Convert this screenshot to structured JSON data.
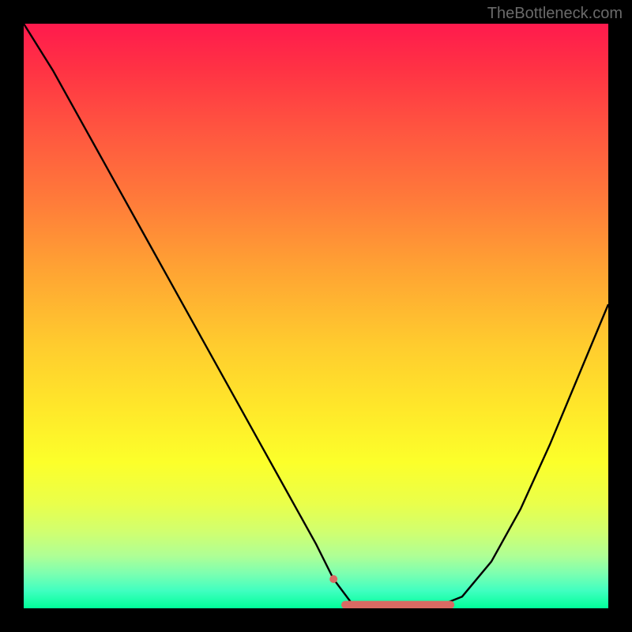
{
  "watermark": "TheBottleneck.com",
  "chart_data": {
    "type": "line",
    "title": "",
    "xlabel": "",
    "ylabel": "",
    "xlim": [
      0,
      100
    ],
    "ylim": [
      0,
      100
    ],
    "series": [
      {
        "name": "bottleneck-curve",
        "x": [
          0,
          5,
          10,
          15,
          20,
          25,
          30,
          35,
          40,
          45,
          50,
          53,
          56,
          60,
          65,
          70,
          75,
          80,
          85,
          90,
          95,
          100
        ],
        "values": [
          100,
          92,
          83,
          74,
          65,
          56,
          47,
          38,
          29,
          20,
          11,
          5,
          1,
          0,
          0,
          0,
          2,
          8,
          17,
          28,
          40,
          52
        ]
      }
    ],
    "background_gradient": {
      "stops": [
        {
          "pos": 0.0,
          "color": "#ff1a4d"
        },
        {
          "pos": 0.3,
          "color": "#ff7a3a"
        },
        {
          "pos": 0.6,
          "color": "#ffe82a"
        },
        {
          "pos": 0.85,
          "color": "#d0ff70"
        },
        {
          "pos": 1.0,
          "color": "#00ff99"
        }
      ]
    },
    "markers": [
      {
        "name": "highlight-dot",
        "x": 53,
        "y": 5,
        "color": "#d96a63"
      },
      {
        "name": "highlight-bar",
        "x0": 55,
        "x1": 73,
        "y": 0.6,
        "color": "#d96a63"
      }
    ]
  }
}
